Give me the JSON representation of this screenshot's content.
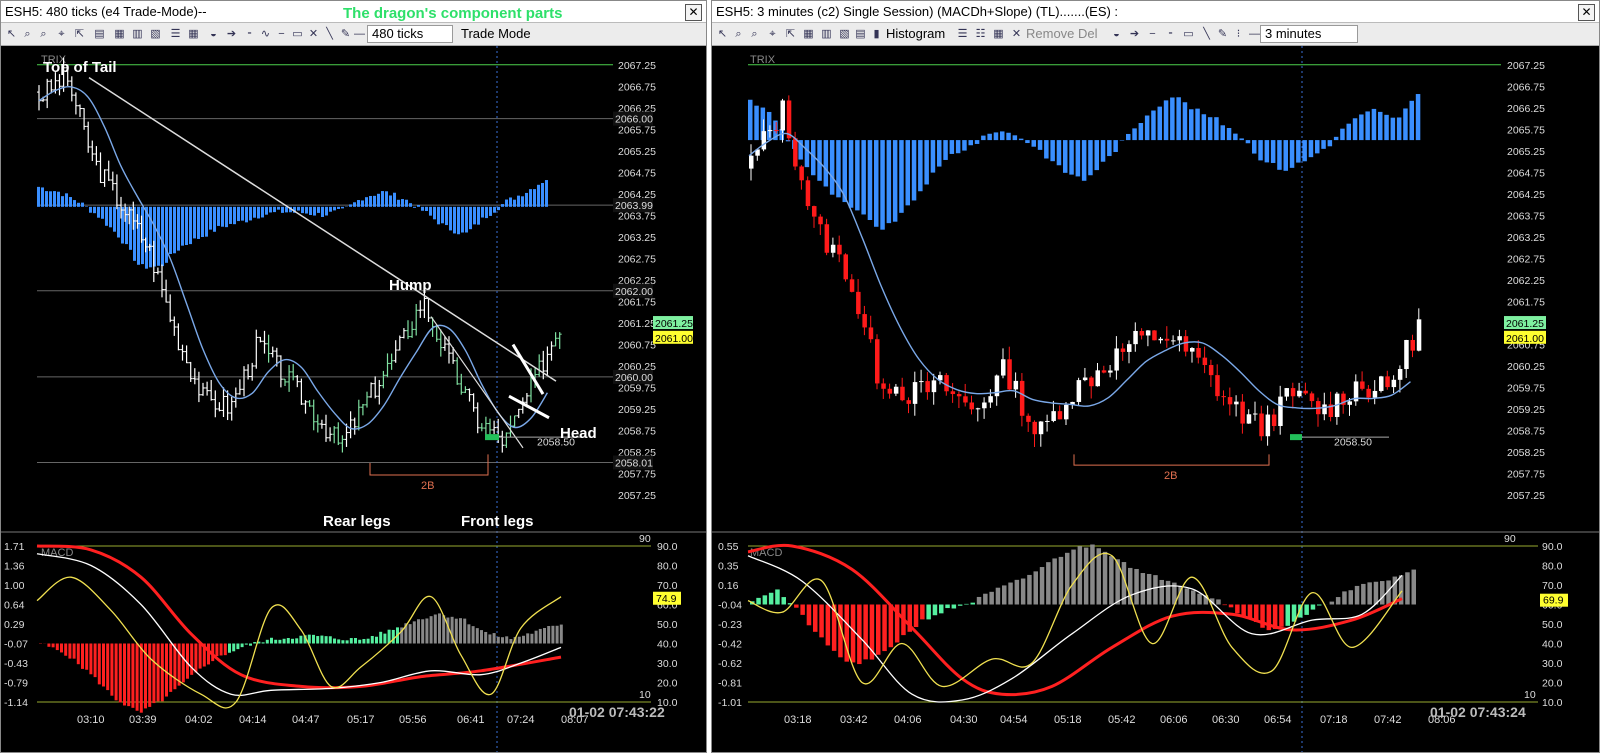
{
  "left": {
    "title": "ESH5: 480 ticks (e4 Trade-Mode)--",
    "dragon_title": "The dragon's component parts",
    "interval": "480 ticks",
    "mode": "Trade Mode",
    "annotations": {
      "top_of_tail": "Top of Tail",
      "hump": "Hump",
      "head": "Head",
      "rear_legs": "Rear legs",
      "front_legs": "Front legs",
      "two_b": "2B"
    },
    "price_boxes": {
      "p1": "2066.00",
      "p2": "2063.99",
      "p3": "2062.00",
      "p4": "2060.00",
      "p5": "2058.50",
      "p6": "2058.01",
      "last_green": "2061.25",
      "last_yellow": "2061.00"
    },
    "trix_label": "TRIX",
    "macd_label": "MACD",
    "macd_axis": [
      "1.71",
      "1.36",
      "1.00",
      "0.64",
      "0.29",
      "-0.07",
      "-0.43",
      "-0.79",
      "-1.14"
    ],
    "osc_axis": [
      "90.0",
      "80.0",
      "70.0",
      "60.0",
      "50.0",
      "40.0",
      "30.0",
      "20.0",
      "10.0"
    ],
    "osc_level_hi": "90",
    "osc_level_lo": "10",
    "osc_value": "74.9",
    "times": [
      "03:10",
      "03:39",
      "04:02",
      "04:14",
      "04:47",
      "05:17",
      "05:56",
      "06:41",
      "07:24",
      "08:07"
    ],
    "datetime": "01-02 07:43:22"
  },
  "right": {
    "title": "ESH5: 3 minutes (c2)  Single Session) (MACDh+Slope) (TL).......(ES) :",
    "histogram_label": "Histogram",
    "remove_label": "Remove Del",
    "interval": "3 minutes",
    "trix_label": "TRIX",
    "macd_label": "MACD",
    "price_boxes": {
      "p5": "2058.50",
      "last_green": "2061.25",
      "last_yellow": "2061.00"
    },
    "annotations": {
      "two_b": "2B"
    },
    "macd_axis": [
      "0.55",
      "0.35",
      "0.16",
      "-0.04",
      "-0.23",
      "-0.42",
      "-0.62",
      "-0.81",
      "-1.01"
    ],
    "osc_axis": [
      "90.0",
      "80.0",
      "70.0",
      "60.0",
      "50.0",
      "40.0",
      "30.0",
      "20.0",
      "10.0"
    ],
    "osc_level_hi": "90",
    "osc_level_lo": "10",
    "osc_value": "69.9",
    "times": [
      "03:18",
      "03:42",
      "04:06",
      "04:30",
      "04:54",
      "05:18",
      "05:42",
      "06:06",
      "06:30",
      "06:54",
      "07:18",
      "07:42",
      "08:06"
    ],
    "datetime": "01-02 07:43:24"
  },
  "price_axis": [
    "2067.25",
    "2066.75",
    "2066.25",
    "2065.75",
    "2065.25",
    "2064.75",
    "2064.25",
    "2063.75",
    "2063.25",
    "2062.75",
    "2062.25",
    "2061.75",
    "2061.25",
    "2060.75",
    "2060.25",
    "2059.75",
    "2059.25",
    "2058.75",
    "2058.25",
    "2057.75",
    "2057.25"
  ],
  "colors": {
    "up": "#ffffff",
    "down": "#ff1a1a",
    "green_bar": "#7fe0a0",
    "hist": "#3a8fff",
    "ma": "#7aa8e8",
    "macd_red": "#ff2020",
    "macd_green": "#55f0a0",
    "signal": "#ffffff",
    "osc": "#f0e050"
  },
  "chart_data": [
    {
      "type": "line",
      "title": "ESH5: 480 ticks (e4 Trade-Mode)--",
      "x": [
        "03:10",
        "03:39",
        "04:02",
        "04:14",
        "04:47",
        "05:17",
        "05:56",
        "06:41",
        "07:24"
      ],
      "series": [
        {
          "values": [
            2066.5,
            2064.5,
            2062.0,
            2059.3,
            2060.5,
            2058.5,
            2061.5,
            2058.5,
            2061.2
          ]
        }
      ],
      "ylim": [
        2057.0,
        2067.5
      ]
    },
    {
      "type": "line",
      "title": "ESH5: 3 minutes (c2)  Single Session) (MACDh+Slope) (TL).......(ES) :",
      "x": [
        "03:18",
        "03:42",
        "04:06",
        "04:30",
        "04:54",
        "05:18",
        "05:42",
        "06:06",
        "06:30",
        "06:54",
        "07:18",
        "07:42"
      ],
      "series": [
        {
          "values": [
            2066.2,
            2063.0,
            2059.5,
            2059.8,
            2059.8,
            2058.6,
            2061.0,
            2061.0,
            2059.2,
            2059.2,
            2060.0,
            2061.2
          ]
        }
      ],
      "ylim": [
        2057.0,
        2067.5
      ]
    }
  ]
}
